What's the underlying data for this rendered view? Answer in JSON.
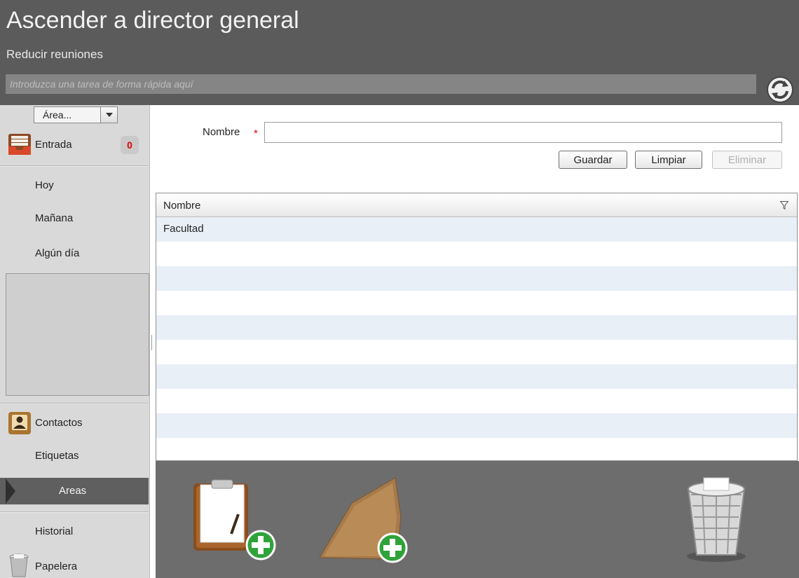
{
  "header": {
    "title": "Ascender a director general",
    "subtitle": "Reducir reuniones",
    "quick_task_placeholder": "Introduzca una tarea de forma rápida aquí",
    "sync_icon": "sync-icon"
  },
  "sidebar": {
    "area_select": {
      "selected": "Área..."
    },
    "inbox": {
      "label": "Entrada",
      "count": "0",
      "icon": "inbox-icon"
    },
    "items": [
      {
        "label": "Hoy"
      },
      {
        "label": "Mañana"
      },
      {
        "label": "Algún día"
      }
    ],
    "contacts": {
      "label": "Contactos",
      "icon": "contacts-icon"
    },
    "tags": {
      "label": "Etiquetas"
    },
    "areas": {
      "label": "Areas",
      "selected": true
    },
    "history": {
      "label": "Historial"
    },
    "trash": {
      "label": "Papelera",
      "icon": "trash-icon"
    }
  },
  "form": {
    "name_label": "Nombre",
    "required_mark": "*",
    "name_value": "",
    "save_label": "Guardar",
    "clear_label": "Limpiar",
    "delete_label": "Eliminar"
  },
  "grid": {
    "column_header": "Nombre",
    "rows": [
      "Facultad",
      "",
      "",
      "",
      "",
      "",
      "",
      "",
      "",
      ""
    ]
  },
  "tray": {
    "icons": [
      "new-task-clipboard-icon",
      "new-project-folder-icon",
      "trash-bin-icon"
    ]
  },
  "colors": {
    "header_bg": "#5b5b5b",
    "sidebar_bg": "#d9d9d9",
    "selected_item_bg": "#5f5f5f",
    "badge_text": "#e00000",
    "add_green": "#2fa33a",
    "row_stripe": "#e9eff7"
  }
}
